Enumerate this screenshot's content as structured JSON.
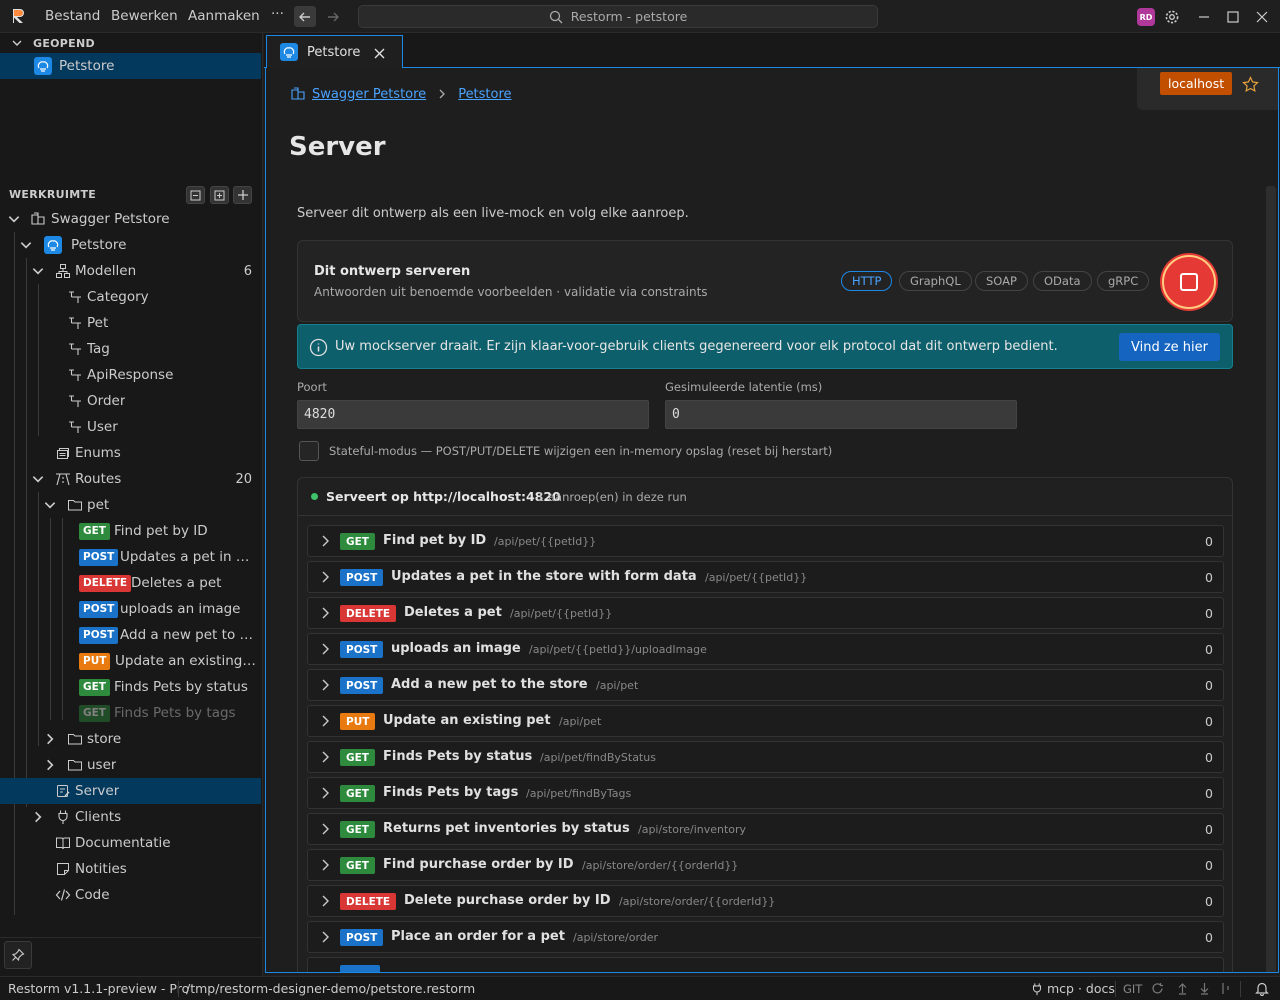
{
  "titlebar": {
    "menu": [
      "Bestand",
      "Bewerken",
      "Aanmaken",
      "···"
    ],
    "search_text": "Restorm - petstore",
    "avatar_initials": "RD"
  },
  "sidebar": {
    "open_section": "GEOPEND",
    "open_item": "Petstore",
    "workspace_section": "WERKRUIMTE",
    "tree": {
      "root": "Swagger Petstore",
      "api": "Petstore",
      "models_label": "Modellen",
      "models_count": "6",
      "models": [
        "Category",
        "Pet",
        "Tag",
        "ApiResponse",
        "Order",
        "User"
      ],
      "enums": "Enums",
      "routes_label": "Routes",
      "routes_count": "20",
      "pet_folder": "pet",
      "pet_routes": [
        {
          "method": "GET",
          "label": "Find pet by ID"
        },
        {
          "method": "POST",
          "label": "Updates a pet in th..."
        },
        {
          "method": "DELETE",
          "label": "Deletes a pet"
        },
        {
          "method": "POST",
          "label": "uploads an image"
        },
        {
          "method": "POST",
          "label": "Add a new pet to th..."
        },
        {
          "method": "PUT",
          "label": "Update an existing pet"
        },
        {
          "method": "GET",
          "label": "Finds Pets by status"
        },
        {
          "method": "GET",
          "label": "Finds Pets by tags"
        }
      ],
      "store_folder": "store",
      "user_folder": "user",
      "server": "Server",
      "clients": "Clients",
      "docs": "Documentatie",
      "notes": "Notities",
      "code": "Code"
    }
  },
  "tab": {
    "label": "Petstore"
  },
  "editor": {
    "breadcrumb": [
      "Swagger Petstore",
      "Petstore"
    ],
    "env_badge": "localhost",
    "title": "Server",
    "description": "Serveer dit ontwerp als een live-mock en volg elke aanroep.",
    "serve_title": "Dit ontwerp serveren",
    "serve_sub": "Antwoorden uit benoemde voorbeelden · validatie via constraints",
    "protocols": [
      "HTTP",
      "GraphQL",
      "SOAP",
      "OData",
      "gRPC"
    ],
    "info_text": "Uw mockserver draait. Er zijn klaar-voor-gebruik clients gegenereerd voor elk protocol dat dit ontwerp bedient.",
    "info_button": "Vind ze hier",
    "port_label": "Poort",
    "port_value": "4820",
    "latency_label": "Gesimuleerde latentie (ms)",
    "latency_value": "0",
    "stateful_label": "Stateful-modus — POST/PUT/DELETE wijzigen een in-memory opslag (reset bij herstart)",
    "serving_text": "Serveert op http://localhost:4820",
    "serving_calls": "1 aanroep(en) in deze run",
    "routes": [
      {
        "method": "GET",
        "name": "Find pet by ID",
        "path": "/api/pet/{{petId}}",
        "count": "0"
      },
      {
        "method": "POST",
        "name": "Updates a pet in the store with form data",
        "path": "/api/pet/{{petId}}",
        "count": "0"
      },
      {
        "method": "DELETE",
        "name": "Deletes a pet",
        "path": "/api/pet/{{petId}}",
        "count": "0"
      },
      {
        "method": "POST",
        "name": "uploads an image",
        "path": "/api/pet/{{petId}}/uploadImage",
        "count": "0"
      },
      {
        "method": "POST",
        "name": "Add a new pet to the store",
        "path": "/api/pet",
        "count": "0"
      },
      {
        "method": "PUT",
        "name": "Update an existing pet",
        "path": "/api/pet",
        "count": "0"
      },
      {
        "method": "GET",
        "name": "Finds Pets by status",
        "path": "/api/pet/findByStatus",
        "count": "0"
      },
      {
        "method": "GET",
        "name": "Finds Pets by tags",
        "path": "/api/pet/findByTags",
        "count": "0"
      },
      {
        "method": "GET",
        "name": "Returns pet inventories by status",
        "path": "/api/store/inventory",
        "count": "0"
      },
      {
        "method": "GET",
        "name": "Find purchase order by ID",
        "path": "/api/store/order/{{orderId}}",
        "count": "0"
      },
      {
        "method": "DELETE",
        "name": "Delete purchase order by ID",
        "path": "/api/store/order/{{orderId}}",
        "count": "0"
      },
      {
        "method": "POST",
        "name": "Place an order for a pet",
        "path": "/api/store/order",
        "count": "0"
      }
    ]
  },
  "statusbar": {
    "version": "Restorm v1.1.1-preview - Pro",
    "path": "/tmp/restorm-designer-demo/petstore.restorm",
    "mcp": "mcp · docs",
    "git": "GIT"
  },
  "colors": {
    "accent": "#1e88e5",
    "get": "#2e8b3d",
    "post": "#1a73c9",
    "delete": "#d93636",
    "put": "#e87a10",
    "stop": "#e53935",
    "info_bg": "#0d5f6b"
  }
}
